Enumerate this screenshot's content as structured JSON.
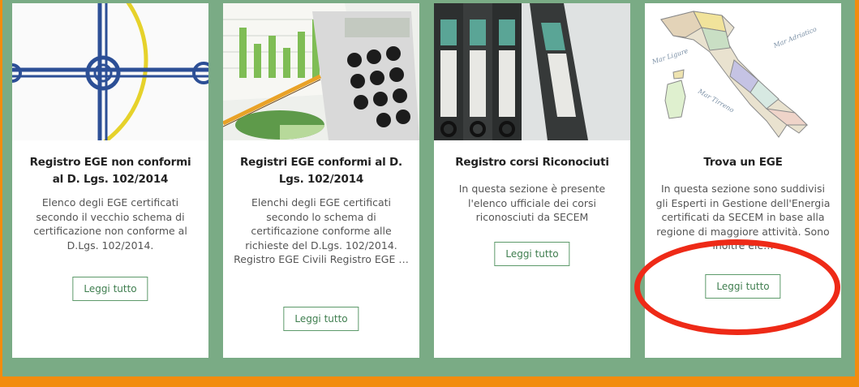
{
  "cards": [
    {
      "title": "Registro EGE non conformi al D. Lgs. 102/2014",
      "description": "Elenco degli EGE certificati secondo il vecchio schema di certificazione non conforme al D.Lgs. 102/2014.",
      "button": "Leggi tutto",
      "image_icon": "map-pin-crosshair-icon"
    },
    {
      "title": "Registri EGE conformi al D. Lgs. 102/2014",
      "description": "Elenchi degli EGE certificati secondo lo schema di certificazione conforme alle richieste del D.Lgs. 102/2014. Registro EGE Civili Registro EGE …",
      "button": "Leggi tutto",
      "image_icon": "calculator-chart-icon"
    },
    {
      "title": "Registro corsi Riconociuti",
      "description": "In questa sezione è presente l'elenco ufficiale dei corsi riconosciuti da SECEM",
      "button": "Leggi tutto",
      "image_icon": "binders-icon"
    },
    {
      "title": "Trova un EGE",
      "description": "In questa sezione sono suddivisi gli Esperti in Gestione dell'Energia certificati da SECEM in base alla regione di maggiore attività. Sono inoltre ele…",
      "button": "Leggi tutto",
      "image_icon": "italy-map-icon"
    }
  ],
  "map_labels": {
    "adriatic": "Mar Adriatico",
    "ligure": "Mar Ligure",
    "tirreno": "Mar Tirreno"
  },
  "colors": {
    "outer_border": "#f28c0f",
    "background": "#7aab85",
    "button_border": "#5d9a6a",
    "annotation": "#ee2a17"
  }
}
